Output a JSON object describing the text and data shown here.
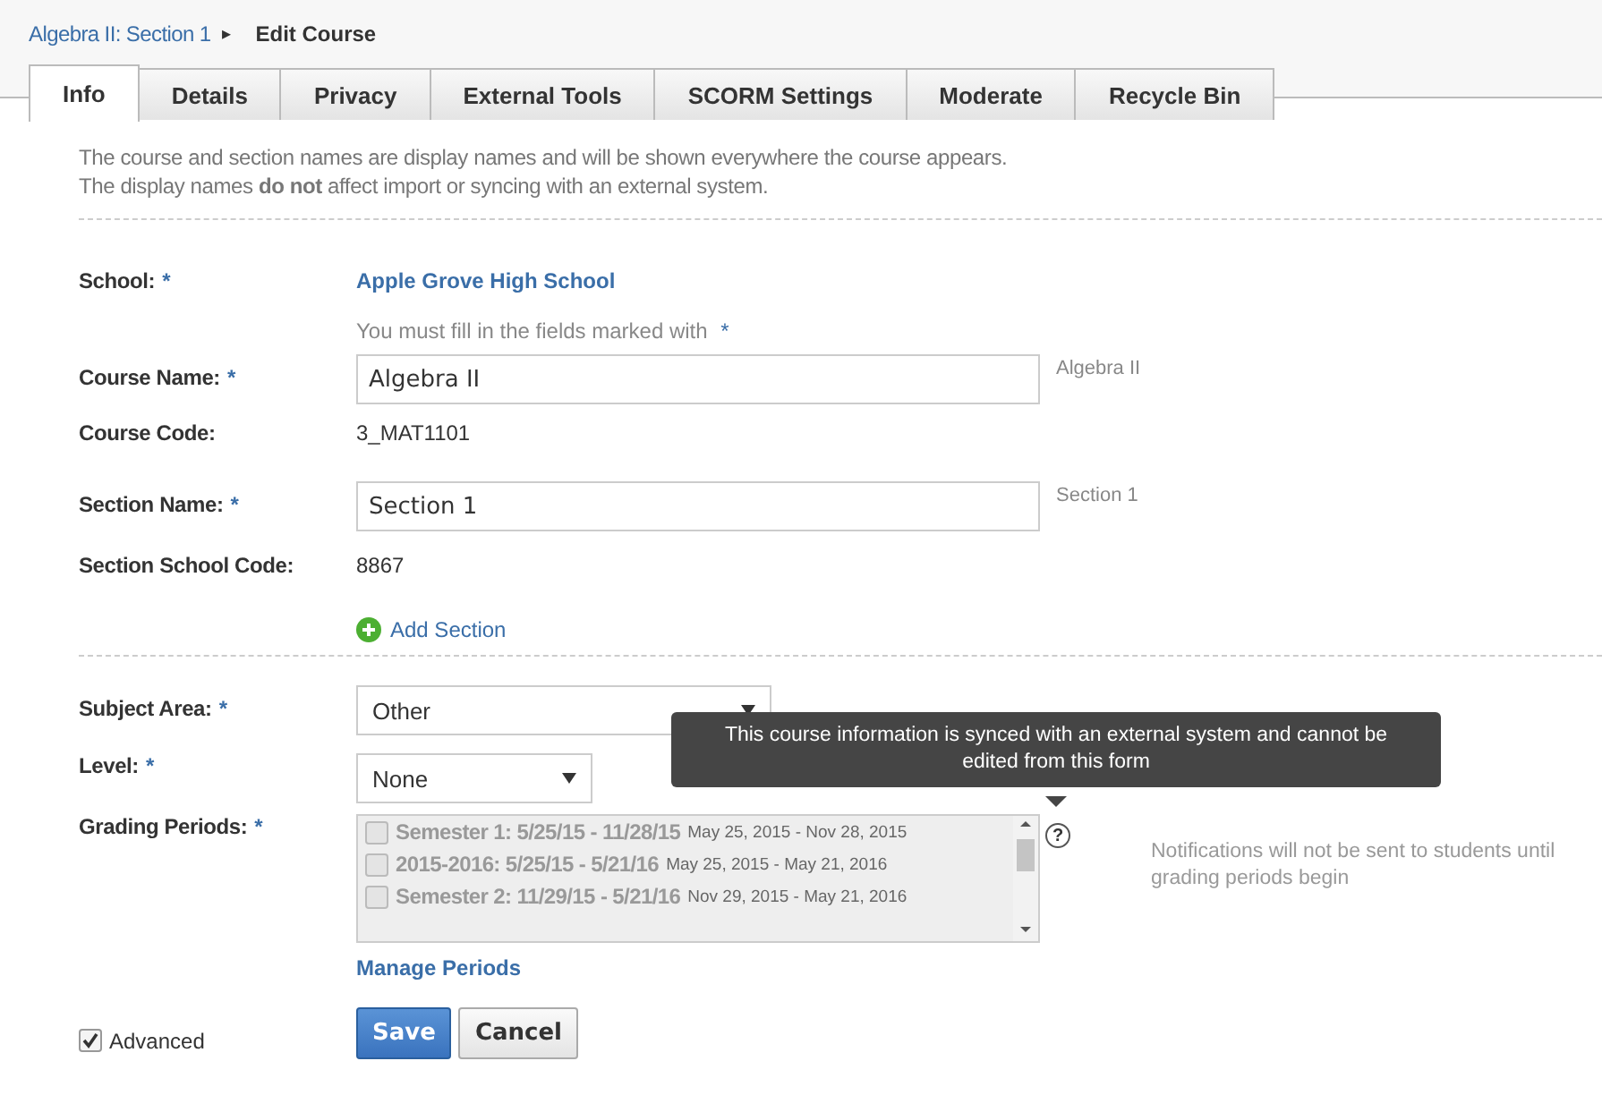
{
  "breadcrumb": {
    "link": "Algebra II: Section 1",
    "arrow": "▸",
    "current": "Edit Course"
  },
  "tabs": [
    {
      "label": "Info",
      "selected": true
    },
    {
      "label": "Details",
      "selected": false
    },
    {
      "label": "Privacy",
      "selected": false
    },
    {
      "label": "External Tools",
      "selected": false
    },
    {
      "label": "SCORM Settings",
      "selected": false
    },
    {
      "label": "Moderate",
      "selected": false
    },
    {
      "label": "Recycle Bin",
      "selected": false
    }
  ],
  "intro": [
    "The course and section names are display names and will be shown everywhere the course appears.",
    "The display names **do not** affect import or syncing with an external system."
  ],
  "school": {
    "label": "School:",
    "required": true,
    "value": "Apple Grove High School"
  },
  "hint": {
    "text": "You must fill in the fields marked with",
    "mark": "*"
  },
  "course_name": {
    "label": "Course Name:",
    "required": true,
    "value": "Algebra II",
    "display": "Algebra II"
  },
  "course_code": {
    "label": "Course Code:",
    "value": "3_MAT1101"
  },
  "section_name": {
    "label": "Section Name:",
    "required": true,
    "value": "Section 1",
    "display": "Section 1"
  },
  "section_school_code": {
    "label": "Section School Code:",
    "value": "8867"
  },
  "add_section": "Add Section",
  "subject_area": {
    "label": "Subject Area:",
    "required": true,
    "value": "Other"
  },
  "level": {
    "label": "Level:",
    "required": true,
    "value": "None"
  },
  "grading_periods": {
    "label": "Grading Periods:",
    "required": true,
    "disabled": true,
    "items": [
      {
        "name": "Semester 1: 5/25/15 - 11/28/15",
        "dates": "May 25, 2015 - Nov 28, 2015",
        "checked": false
      },
      {
        "name": "2015-2016: 5/25/15 - 5/21/16",
        "dates": "May 25, 2015 - May 21, 2016",
        "checked": false
      },
      {
        "name": "Semester 2: 11/29/15 - 5/21/16",
        "dates": "Nov 29, 2015 - May 21, 2016",
        "checked": false
      }
    ],
    "help": "?",
    "note": "Notifications will not be sent to students until grading periods begin",
    "manage": "Manage Periods"
  },
  "tooltip": "This course information is synced with an external system and cannot be edited from this form",
  "advanced": {
    "label": "Advanced",
    "checked": true
  },
  "buttons": [
    "Save",
    "Cancel"
  ]
}
